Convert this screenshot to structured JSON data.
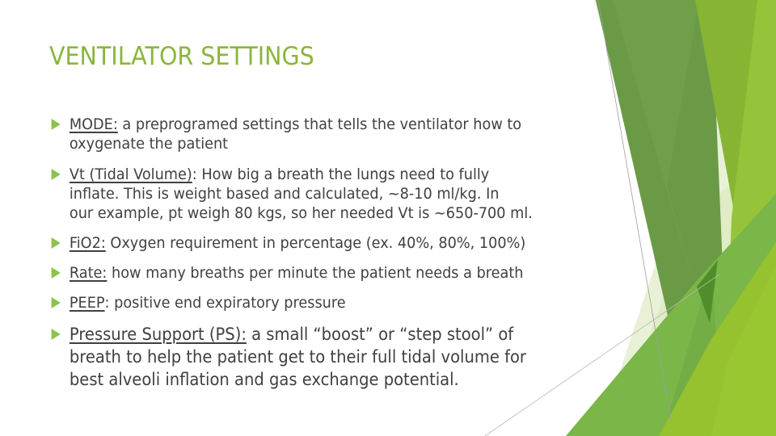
{
  "slide": {
    "title": "VENTILATOR SETTINGS",
    "colors": {
      "title": "#8BB53D",
      "body_text": "#404040",
      "bullet_arrow": "#8BC34A",
      "facet_dark": "#6B9A46",
      "facet_mid": "#7AB648",
      "facet_lime": "#95C22E",
      "facet_light": "#DCEBC0"
    },
    "bullets": [
      {
        "term": "MODE:",
        "lines": [
          "a preprogramed settings that tells the ventilator how to",
          "oxygenate the patient"
        ]
      },
      {
        "term": "Vt (Tidal Volume)",
        "after_term": ":",
        "lines": [
          "How big a breath the lungs need to fully",
          "inflate.  This is weight based and calculated, ~8-10 ml/kg.  In",
          "our example, pt weigh 80 kgs, so her needed Vt is ~650-700 ml."
        ]
      },
      {
        "term": "FiO2:",
        "lines": [
          " Oxygen requirement in percentage (ex. 40%, 80%, 100%)"
        ]
      },
      {
        "term": "Rate:",
        "lines": "how many breaths per minute the patient needs a breath"
      },
      {
        "term": "PEEP",
        "after_term": ":",
        "lines": "positive end expiratory pressure"
      },
      {
        "term": "Pressure Support (PS):",
        "lines": [
          "a small “boost” or “step stool” of",
          "breath to help the patient get to their full tidal volume for",
          "best alveoli inflation and gas exchange potential."
        ]
      }
    ]
  }
}
